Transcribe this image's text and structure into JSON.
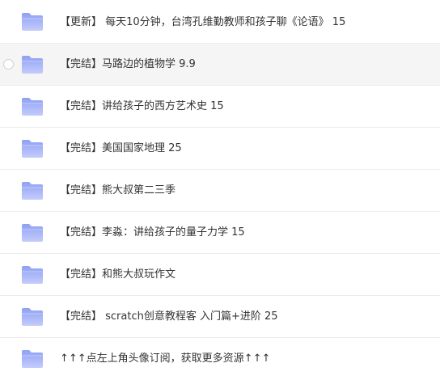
{
  "file_list": {
    "items": [
      {
        "name": "【更新】 每天10分钟，台湾孔维勤教师和孩子聊《论语》 15",
        "icon": "folder-icon"
      },
      {
        "name": "【完结】马路边的植物学 9.9",
        "icon": "folder-icon"
      },
      {
        "name": "【完结】讲给孩子的西方艺术史 15",
        "icon": "folder-icon"
      },
      {
        "name": "【完结】美国国家地理 25",
        "icon": "folder-icon"
      },
      {
        "name": "【完结】熊大叔第二三季",
        "icon": "folder-icon"
      },
      {
        "name": "【完结】李淼：讲给孩子的量子力学 15",
        "icon": "folder-icon"
      },
      {
        "name": "【完结】和熊大叔玩作文",
        "icon": "folder-icon"
      },
      {
        "name": "【完结】 scratch创意教程客 入门篇+进阶 25",
        "icon": "folder-icon"
      },
      {
        "name": "↑↑↑点左上角头像订阅，获取更多资源↑↑↑",
        "icon": "folder-icon"
      }
    ]
  },
  "colors": {
    "folder_top": "#8ea0f4",
    "folder_bottom": "#c5ccfb",
    "row_hover": "#f5f5f6",
    "divider": "#ececec",
    "text": "#333333"
  }
}
